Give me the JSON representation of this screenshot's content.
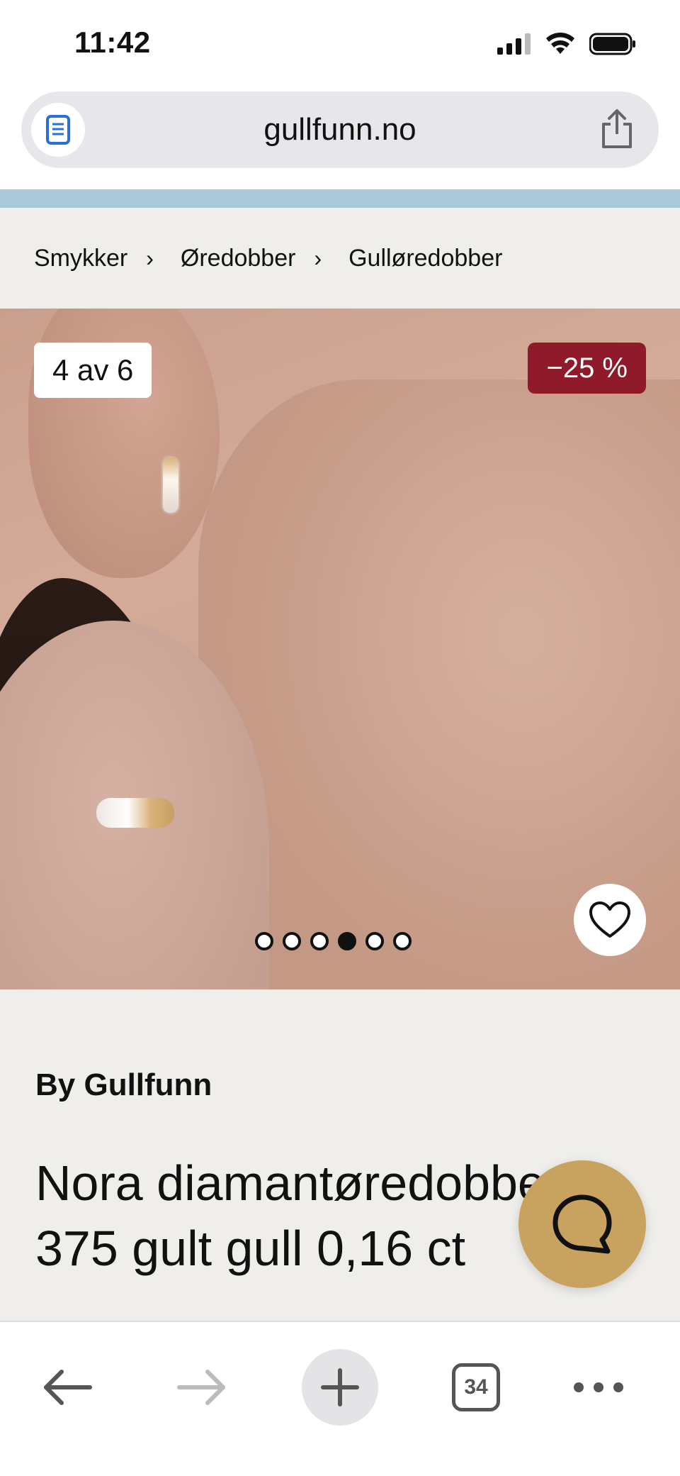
{
  "status_bar": {
    "time": "11:42"
  },
  "browser": {
    "url": "gullfunn.no",
    "tab_count": "34"
  },
  "breadcrumb": {
    "items": [
      "Smykker",
      "Øredobber",
      "Gulløredobber"
    ],
    "separator": "›"
  },
  "gallery": {
    "counter": "4 av 6",
    "discount": "−25 %",
    "total_images": 6,
    "active_index": 4
  },
  "product": {
    "brand": "By Gullfunn",
    "title": "Nora diamantøredobber i 375 gult gull 0,16 ct"
  },
  "colors": {
    "accent_strip": "#a9c8d8",
    "discount_badge": "#8e1a2a",
    "chat_button": "#c8a360",
    "page_background": "#efeeeb"
  },
  "icons": {
    "reader": "reader-mode-icon",
    "share": "share-icon",
    "favorite": "heart-icon",
    "chat": "chat-bubble-icon",
    "back": "arrow-left-icon",
    "forward": "arrow-right-icon",
    "new_tab": "plus-icon",
    "tabs": "tabs-icon",
    "more": "more-dots-icon"
  }
}
